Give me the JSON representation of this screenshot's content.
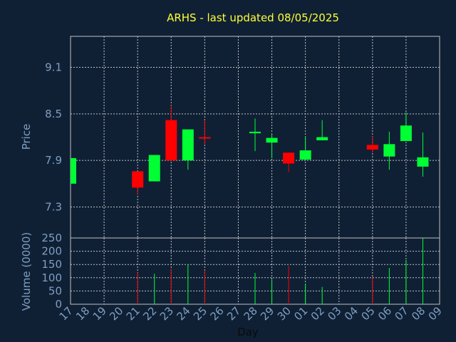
{
  "chart_data": [
    {
      "type": "candlestick",
      "title": "ARHS - last updated 08/05/2025",
      "ylabel": "Price",
      "ylim": [
        6.9,
        9.5
      ],
      "yticks": [
        "9.1",
        "8.5",
        "7.9",
        "7.3"
      ],
      "grid": true,
      "colors": {
        "up": "#00ff33",
        "down": "#ff0000",
        "grid": "#c0c0c0",
        "frame": "#c0c0c0"
      },
      "x": [
        "17",
        "18",
        "19",
        "20",
        "21",
        "22",
        "23",
        "24",
        "25",
        "26",
        "27",
        "28",
        "29",
        "30",
        "01",
        "02",
        "03",
        "04",
        "05",
        "06",
        "07",
        "08",
        "09"
      ],
      "candles": [
        {
          "day": "17",
          "open": 7.6,
          "close": 7.93,
          "high": 7.93,
          "low": 7.6
        },
        {
          "day": "21",
          "open": 7.76,
          "close": 7.55,
          "high": 7.76,
          "low": 7.46
        },
        {
          "day": "22",
          "open": 7.63,
          "close": 7.97,
          "high": 7.97,
          "low": 7.63
        },
        {
          "day": "23",
          "open": 8.42,
          "close": 7.9,
          "high": 8.61,
          "low": 7.9
        },
        {
          "day": "24",
          "open": 7.9,
          "close": 8.3,
          "high": 8.3,
          "low": 7.78
        },
        {
          "day": "25",
          "open": 8.2,
          "close": 8.19,
          "high": 8.42,
          "low": 8.11
        },
        {
          "day": "28",
          "open": 8.25,
          "close": 8.27,
          "high": 8.44,
          "low": 8.02
        },
        {
          "day": "29",
          "open": 8.13,
          "close": 8.19,
          "high": 8.25,
          "low": 7.93
        },
        {
          "day": "30",
          "open": 8.0,
          "close": 7.86,
          "high": 8.0,
          "low": 7.75
        },
        {
          "day": "01",
          "open": 7.91,
          "close": 8.03,
          "high": 8.21,
          "low": 7.91
        },
        {
          "day": "02",
          "open": 8.16,
          "close": 8.2,
          "high": 8.42,
          "low": 8.16
        },
        {
          "day": "05",
          "open": 8.1,
          "close": 8.04,
          "high": 8.21,
          "low": 8.0
        },
        {
          "day": "06",
          "open": 7.95,
          "close": 8.11,
          "high": 8.27,
          "low": 7.78
        },
        {
          "day": "07",
          "open": 8.15,
          "close": 8.35,
          "high": 8.52,
          "low": 8.15
        },
        {
          "day": "08",
          "open": 7.82,
          "close": 7.94,
          "high": 8.26,
          "low": 7.69
        }
      ]
    },
    {
      "type": "bar",
      "ylabel": "Volume (0000)",
      "xlabel": "Day",
      "ylim": [
        0,
        250
      ],
      "yticks": [
        "250",
        "200",
        "150",
        "100",
        "50",
        "0"
      ],
      "grid": true,
      "bars": [
        {
          "day": "21",
          "value": 120,
          "color": "down"
        },
        {
          "day": "22",
          "value": 115,
          "color": "up"
        },
        {
          "day": "23",
          "value": 133,
          "color": "down"
        },
        {
          "day": "24",
          "value": 150,
          "color": "up"
        },
        {
          "day": "25",
          "value": 128,
          "color": "down"
        },
        {
          "day": "28",
          "value": 118,
          "color": "up"
        },
        {
          "day": "29",
          "value": 93,
          "color": "up"
        },
        {
          "day": "30",
          "value": 145,
          "color": "down"
        },
        {
          "day": "01",
          "value": 78,
          "color": "up"
        },
        {
          "day": "02",
          "value": 65,
          "color": "up"
        },
        {
          "day": "05",
          "value": 105,
          "color": "down"
        },
        {
          "day": "06",
          "value": 137,
          "color": "up"
        },
        {
          "day": "07",
          "value": 167,
          "color": "up"
        },
        {
          "day": "08",
          "value": 250,
          "color": "up"
        }
      ]
    }
  ]
}
